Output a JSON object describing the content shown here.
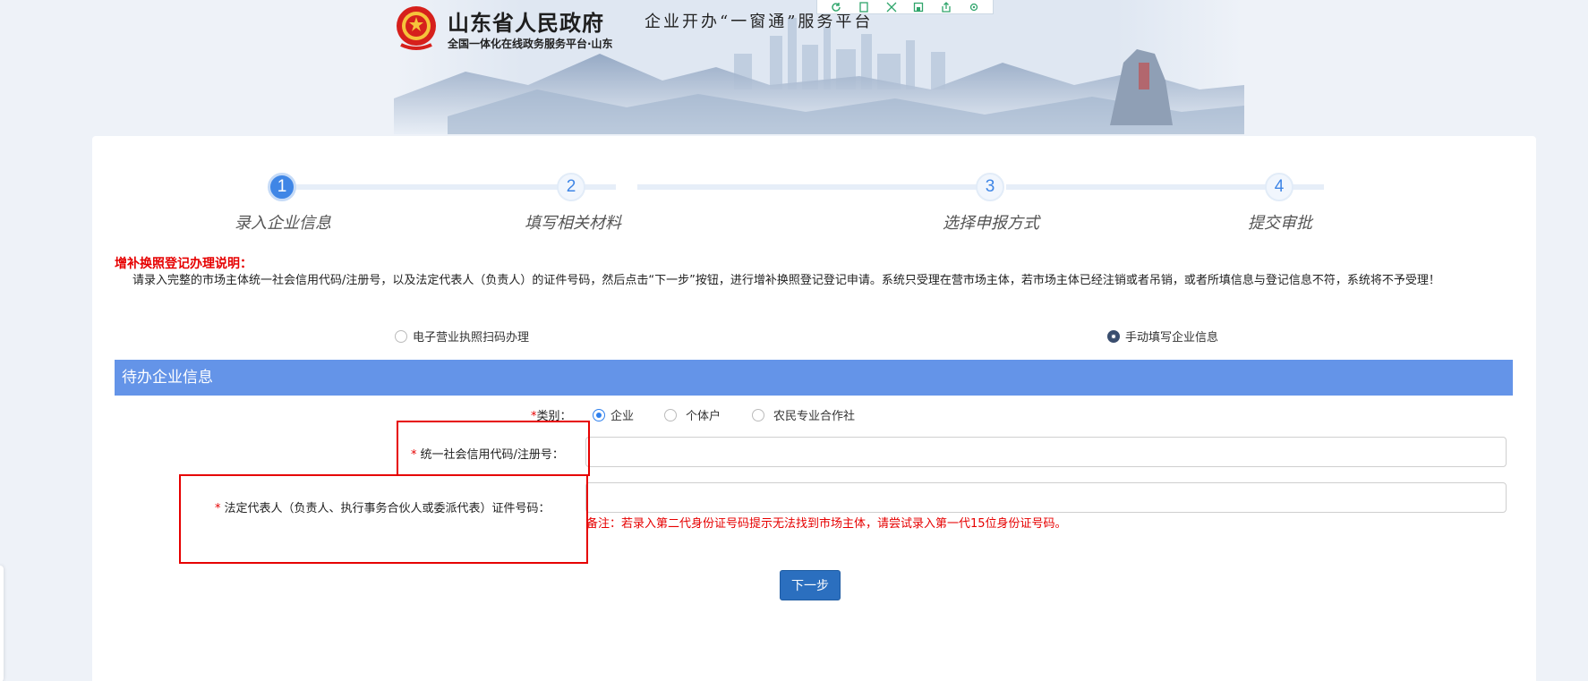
{
  "header": {
    "site_title": "山东省人民政府",
    "site_subtitle": "全国一体化在线政务服务平台·山东",
    "platform_title": "企业开办“一窗通”服务平台",
    "toolbar_icons": [
      "refresh-icon",
      "copy-icon",
      "expand-icon",
      "save-icon",
      "share-icon",
      "settings-icon"
    ]
  },
  "steps": [
    {
      "number": "1",
      "label": "录入企业信息",
      "active": true
    },
    {
      "number": "2",
      "label": "填写相关材料",
      "active": false
    },
    {
      "number": "3",
      "label": "选择申报方式",
      "active": false
    },
    {
      "number": "4",
      "label": "提交审批",
      "active": false
    }
  ],
  "notice": {
    "title": "增补换照登记办理说明：",
    "body": "请录入完整的市场主体统一社会信用代码/注册号，以及法定代表人（负责人）的证件号码，然后点击“下一步”按钮，进行增补换照登记登记申请。系统只受理在营市场主体，若市场主体已经注销或者吊销，或者所填信息与登记信息不符，系统将不予受理！"
  },
  "mode_options": {
    "scan": "电子营业执照扫码办理",
    "manual": "手动填写企业信息",
    "selected": "manual"
  },
  "section": {
    "title": "待办企业信息"
  },
  "form": {
    "type_label": "类别：",
    "type_options": [
      "企业",
      "个体户",
      "农民专业合作社"
    ],
    "type_selected": "企业",
    "credit_code_label": "统一社会信用代码/注册号：",
    "credit_code_value": "",
    "id_number_label": "法定代表人（负责人、执行事务合伙人或委派代表）证件号码：",
    "id_number_value": "",
    "required_mark": "*",
    "hint": "备注：若录入第二代身份证号码提示无法找到市场主体，请尝试录入第一代15位身份证号码。",
    "next_button": "下一步"
  },
  "colors": {
    "accent": "#3f86e6",
    "section_bar": "#6494e8",
    "warning": "#e60000",
    "button": "#2b6fbf"
  }
}
